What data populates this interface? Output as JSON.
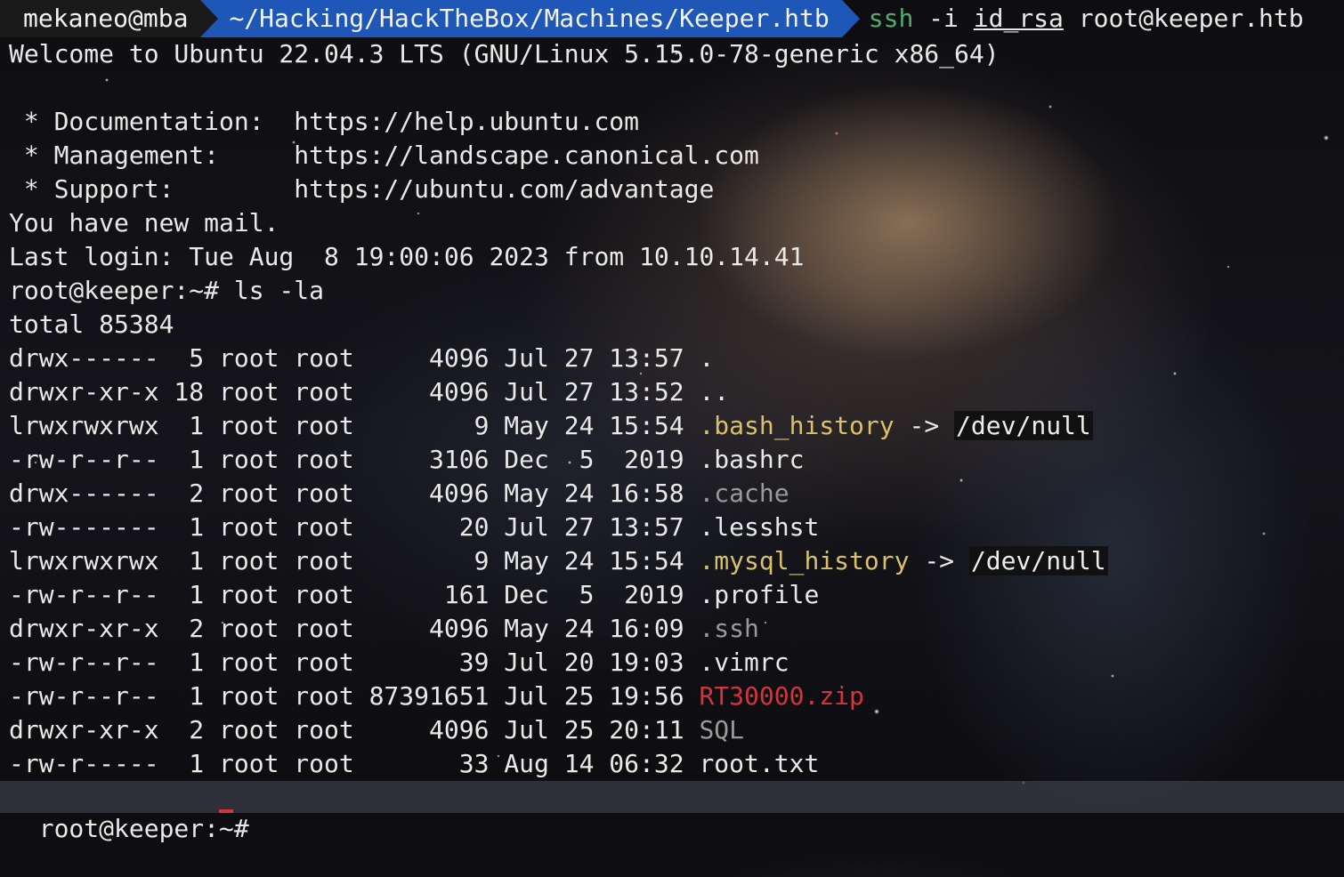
{
  "prompt": {
    "user_host": "mekaneo@mba",
    "path": "~/Hacking/HackTheBox/Machines/Keeper.htb",
    "command_name": "ssh",
    "command_flag": "-i",
    "command_keyfile": "id_rsa",
    "command_target": "root@keeper.htb"
  },
  "motd": {
    "welcome": "Welcome to Ubuntu 22.04.3 LTS (GNU/Linux 5.15.0-78-generic x86_64)",
    "documentation": " * Documentation:  https://help.ubuntu.com",
    "management": " * Management:     https://landscape.canonical.com",
    "support": " * Support:        https://ubuntu.com/advantage",
    "mail": "You have new mail.",
    "last_login": "Last login: Tue Aug  8 19:00:06 2023 from 10.10.14.41"
  },
  "remote_command": "root@keeper:~# ls -la",
  "total": "total 85384",
  "listing": [
    {
      "meta": "drwx------  5 root root     4096 Jul 27 13:57 ",
      "name": ".",
      "style": "plain",
      "arrow": "",
      "target": ""
    },
    {
      "meta": "drwxr-xr-x 18 root root     4096 Jul 27 13:52 ",
      "name": "..",
      "style": "plain",
      "arrow": "",
      "target": ""
    },
    {
      "meta": "lrwxrwxrwx  1 root root        9 May 24 15:54 ",
      "name": ".bash_history",
      "style": "yellow",
      "arrow": " -> ",
      "target": "/dev/null"
    },
    {
      "meta": "-rw-r--r--  1 root root     3106 Dec  5  2019 ",
      "name": ".bashrc",
      "style": "plain",
      "arrow": "",
      "target": ""
    },
    {
      "meta": "drwx------  2 root root     4096 May 24 16:58 ",
      "name": ".cache",
      "style": "gray",
      "arrow": "",
      "target": ""
    },
    {
      "meta": "-rw-------  1 root root       20 Jul 27 13:57 ",
      "name": ".lesshst",
      "style": "plain",
      "arrow": "",
      "target": ""
    },
    {
      "meta": "lrwxrwxrwx  1 root root        9 May 24 15:54 ",
      "name": ".mysql_history",
      "style": "yellow",
      "arrow": " -> ",
      "target": "/dev/null"
    },
    {
      "meta": "-rw-r--r--  1 root root      161 Dec  5  2019 ",
      "name": ".profile",
      "style": "plain",
      "arrow": "",
      "target": ""
    },
    {
      "meta": "drwxr-xr-x  2 root root     4096 May 24 16:09 ",
      "name": ".ssh",
      "style": "gray",
      "arrow": "",
      "target": ""
    },
    {
      "meta": "-rw-r--r--  1 root root       39 Jul 20 19:03 ",
      "name": ".vimrc",
      "style": "plain",
      "arrow": "",
      "target": ""
    },
    {
      "meta": "-rw-r--r--  1 root root 87391651 Jul 25 19:56 ",
      "name": "RT30000.zip",
      "style": "red",
      "arrow": "",
      "target": ""
    },
    {
      "meta": "drwxr-xr-x  2 root root     4096 Jul 25 20:11 ",
      "name": "SQL",
      "style": "gray",
      "arrow": "",
      "target": ""
    },
    {
      "meta": "-rw-r-----  1 root root       33 Aug 14 06:32 ",
      "name": "root.txt",
      "style": "plain",
      "arrow": "",
      "target": ""
    }
  ],
  "final_prompt": "root@keeper:~#",
  "colors": {
    "path_segment": "#1f57b8",
    "user_segment": "#1a1a1a",
    "command_green": "#4fae6b",
    "symlink_yellow": "#d9c16b",
    "dir_gray": "#9a9a98",
    "archive_red": "#d3343e"
  }
}
